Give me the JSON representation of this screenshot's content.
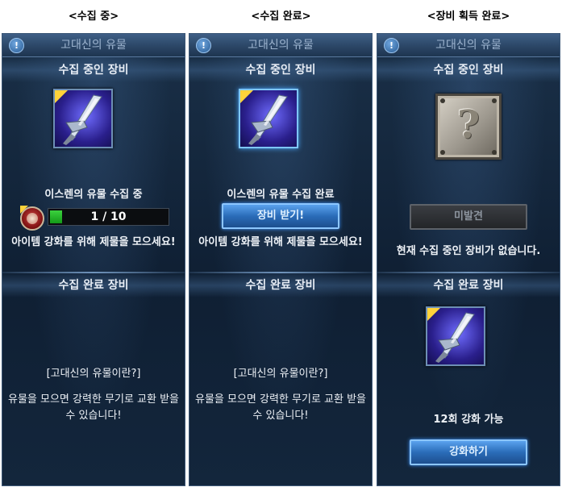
{
  "captions": {
    "collecting": "<수집 중>",
    "complete": "<수집 완료>",
    "acquired": "<장비 획득 완료>"
  },
  "panel_title": "고대신의 유물",
  "section": {
    "collecting_equipment": "수집 중인 장비",
    "completed_equipment": "수집 완료 장비"
  },
  "panel1": {
    "status": "이스렌의 유물 수집 중",
    "progress_text": "1 / 10",
    "progress_current": 1,
    "progress_total": 10,
    "message": "아이템 강화를 위해 제물을 모으세요!",
    "info_title": "[고대신의 유물이란?]",
    "info_text": "유물을 모으면 강력한 무기로 교환 받을 수 있습니다!"
  },
  "panel2": {
    "status": "이스렌의 유물 수집 완료",
    "receive_button": "장비 받기!",
    "message": "아이템 강화를 위해 제물을 모으세요!",
    "info_title": "[고대신의 유물이란?]",
    "info_text": "유물을 모으면 강력한 무기로 교환 받을 수 있습니다!"
  },
  "panel3": {
    "undiscovered_button": "미발견",
    "message": "현재 수집 중인 장비가 없습니다.",
    "enhance_info": "12회 강화 가능",
    "enhance_button": "강화하기"
  },
  "colors": {
    "progress_fill": "#2bbd2e",
    "accent_blue": "#3d95ff",
    "corner_tag": "#ffd23a"
  }
}
